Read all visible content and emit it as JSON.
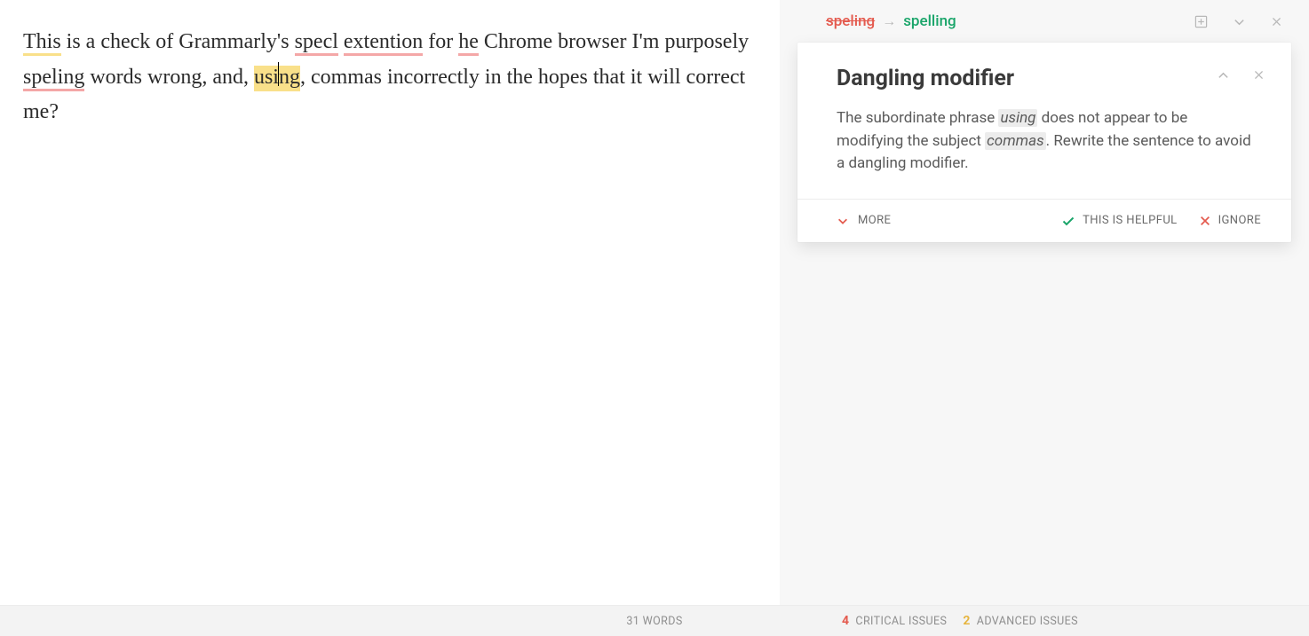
{
  "editor": {
    "seg": [
      "This",
      " is a check of Grammarly's ",
      "specl",
      " ",
      "extention",
      " for ",
      "he",
      " Chrome browser I'm purposely ",
      "speling",
      " words wrong, and, ",
      "usi",
      "ng",
      ", commas incorrectly in the hopes that it will correct me?"
    ]
  },
  "collapsed": {
    "wrong": "speling",
    "fix": "spelling"
  },
  "card": {
    "title": "Dangling modifier",
    "t1": "The subordinate phrase ",
    "k1": "using",
    "t2": " does not appear to be modifying the subject ",
    "k2": "commas",
    "t3": ". Rewrite the sentence to avoid a dangling modifier.",
    "more": "MORE",
    "helpful": "THIS IS HELPFUL",
    "ignore": "IGNORE"
  },
  "bottom": {
    "words": "31 WORDS",
    "crit_n": "4",
    "crit_l": "CRITICAL ISSUES",
    "adv_n": "2",
    "adv_l": "ADVANCED ISSUES"
  }
}
